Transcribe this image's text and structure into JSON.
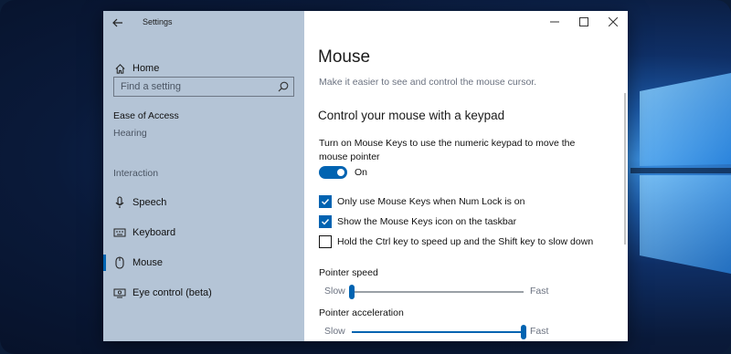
{
  "window": {
    "title": "Settings"
  },
  "sidebar": {
    "home_label": "Home",
    "search_placeholder": "Find a setting",
    "section_title": "Ease of Access",
    "section_subitem": "Hearing",
    "group_title": "Interaction",
    "items": [
      {
        "label": "Speech",
        "icon": "microphone-icon"
      },
      {
        "label": "Keyboard",
        "icon": "keyboard-icon"
      },
      {
        "label": "Mouse",
        "icon": "mouse-icon",
        "active": true
      },
      {
        "label": "Eye control (beta)",
        "icon": "eye-control-icon"
      }
    ]
  },
  "main": {
    "title": "Mouse",
    "description": "Make it easier to see and control the mouse cursor.",
    "section_heading": "Control your mouse with a keypad",
    "mouse_keys_text": "Turn on Mouse Keys to use the numeric keypad to move the mouse pointer",
    "toggle": {
      "state_label": "On",
      "on": true
    },
    "checkboxes": [
      {
        "label": "Only use Mouse Keys when Num Lock is on",
        "checked": true
      },
      {
        "label": "Show the Mouse Keys icon on the taskbar",
        "checked": true
      },
      {
        "label": "Hold the Ctrl key to speed up and the Shift key to slow down",
        "checked": false
      }
    ],
    "pointer_speed": {
      "title": "Pointer speed",
      "min_label": "Slow",
      "max_label": "Fast",
      "value_fraction": 0.0
    },
    "pointer_acceleration": {
      "title": "Pointer acceleration",
      "min_label": "Slow",
      "max_label": "Fast",
      "value_fraction": 1.0
    }
  },
  "colors": {
    "accent": "#0063b1",
    "sidebar_bg": "#b4c4d6",
    "desktop_bg": "#0b1c38"
  }
}
